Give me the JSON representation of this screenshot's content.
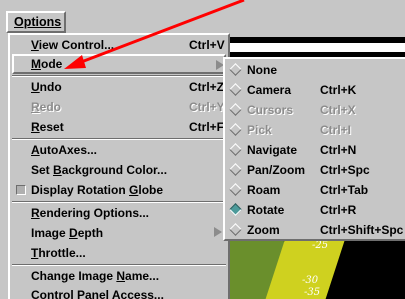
{
  "menubar": {
    "options_label": "Options"
  },
  "menu": {
    "items": [
      {
        "label": "View Control...",
        "accel": "Ctrl+V",
        "underline": "V"
      },
      {
        "label": "Mode",
        "accel": "",
        "underline": "M",
        "cascade": true
      },
      {
        "label": "Undo",
        "accel": "Ctrl+Z",
        "underline": "U"
      },
      {
        "label": "Redo",
        "accel": "Ctrl+Y",
        "underline": "R",
        "disabled": true
      },
      {
        "label": "Reset",
        "accel": "Ctrl+F",
        "underline": "R"
      },
      {
        "label": "AutoAxes...",
        "accel": "",
        "underline": "A"
      },
      {
        "label": "Set Background Color...",
        "accel": "",
        "underline": "B"
      },
      {
        "label": "Display Rotation Globe",
        "accel": "",
        "underline": "G",
        "toggle": true
      },
      {
        "label": "Rendering Options...",
        "accel": "",
        "underline": "R"
      },
      {
        "label": "Image Depth",
        "accel": "",
        "underline": "D",
        "cascade": true
      },
      {
        "label": "Throttle...",
        "accel": "",
        "underline": "T"
      },
      {
        "label": "Change Image Name...",
        "accel": "",
        "underline": "N"
      },
      {
        "label": "Control Panel Access...",
        "accel": "",
        "underline": ""
      }
    ]
  },
  "mode_submenu": {
    "items": [
      {
        "label": "None",
        "accel": "",
        "selected": false
      },
      {
        "label": "Camera",
        "accel": "Ctrl+K",
        "selected": false
      },
      {
        "label": "Cursors",
        "accel": "Ctrl+X",
        "disabled": true,
        "selected": false
      },
      {
        "label": "Pick",
        "accel": "Ctrl+I",
        "disabled": true,
        "selected": false
      },
      {
        "label": "Navigate",
        "accel": "Ctrl+N",
        "selected": false
      },
      {
        "label": "Pan/Zoom",
        "accel": "Ctrl+Spc",
        "selected": false
      },
      {
        "label": "Roam",
        "accel": "Ctrl+Tab",
        "selected": false
      },
      {
        "label": "Rotate",
        "accel": "Ctrl+R",
        "selected": true
      },
      {
        "label": "Zoom",
        "accel": "Ctrl+Shift+Spc",
        "selected": false
      }
    ]
  },
  "viewer": {
    "labels": [
      "-25",
      "-30",
      "-35"
    ]
  },
  "colors": {
    "menu_bg": "#c6c6c6",
    "selected_diamond": "#4c9a9a",
    "annotation_arrow": "#ff0000"
  }
}
